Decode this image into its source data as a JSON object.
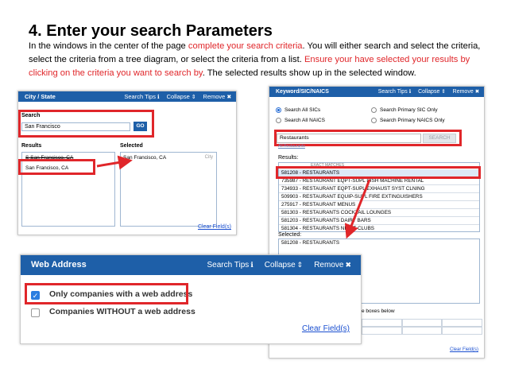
{
  "heading": "4. Enter your search Parameters",
  "intro": {
    "p1": "In the windows in the center of the page ",
    "r1": "complete your search criteria",
    "p2": ".  You will either search and select the criteria, select the criteria from a tree diagram, or select the criteria from a list. ",
    "r2": "Ensure your have selected your results by clicking on the criteria you want to search by",
    "p3": ".  The selected results show up in the selected window."
  },
  "city_panel": {
    "title": "City / State",
    "search_tips": "Search Tips",
    "collapse": "Collapse",
    "remove": "Remove",
    "search_label": "Search",
    "search_value": "San Francisco",
    "go": "GO",
    "results_label": "Results",
    "selected_label": "Selected",
    "results": [
      "S San Francisco, CA",
      "San Francisco, CA"
    ],
    "selected_item": "San Francisco, CA",
    "selected_tag": "City",
    "clear": "Clear Field(s)"
  },
  "keyword_panel": {
    "title": "Keyword/SIC/NAICS",
    "search_tips": "Search Tips",
    "collapse": "Collapse",
    "remove": "Remove",
    "radios": [
      "Search All SICs",
      "Search Primary SIC Only",
      "Search All NAICS",
      "Search Primary NAICS Only"
    ],
    "search_value": "Restaurants",
    "search_button": "SEARCH",
    "all_link": "All Restaurants",
    "results_label": "Results:",
    "exact_header": "EXACT MATCHES",
    "results": [
      "581208 - RESTAURANTS",
      "735987 - RESTAURANT EQPT-SUPL DISH MACHINE RENTAL",
      "734933 - RESTAURANT EQPT-SUPL EXHAUST SYST CLNING",
      "509903 - RESTAURANT EQUIP-SUPL FIRE EXTINGUISHERS",
      "275917 - RESTAURANT MENUS",
      "581303 - RESTAURANTS COCKTAIL LOUNGES",
      "581203 - RESTAURANTS DAIRY BARS",
      "581304 - RESTAURANTS NIGHT CLUBS"
    ],
    "selected_label": "Selected:",
    "selected_item": "581208 - RESTAURANTS",
    "boxes_text": "e boxes below",
    "clear": "Clear Field(s)"
  },
  "web_panel": {
    "title": "Web Address",
    "search_tips": "Search Tips",
    "collapse": "Collapse",
    "remove": "Remove",
    "option_with": "Only companies with a web address",
    "option_without": "Companies WITHOUT a web address",
    "clear": "Clear Field(s)"
  },
  "icons": {
    "info": "info-icon",
    "collapse": "sort-arrows-icon",
    "remove": "close-icon",
    "checkmark": "checkmark-icon"
  },
  "colors": {
    "header_blue": "#1e5fa8",
    "highlight_red": "#e0262a",
    "link_blue": "#1a4fd0",
    "check_blue": "#2a7de0"
  }
}
